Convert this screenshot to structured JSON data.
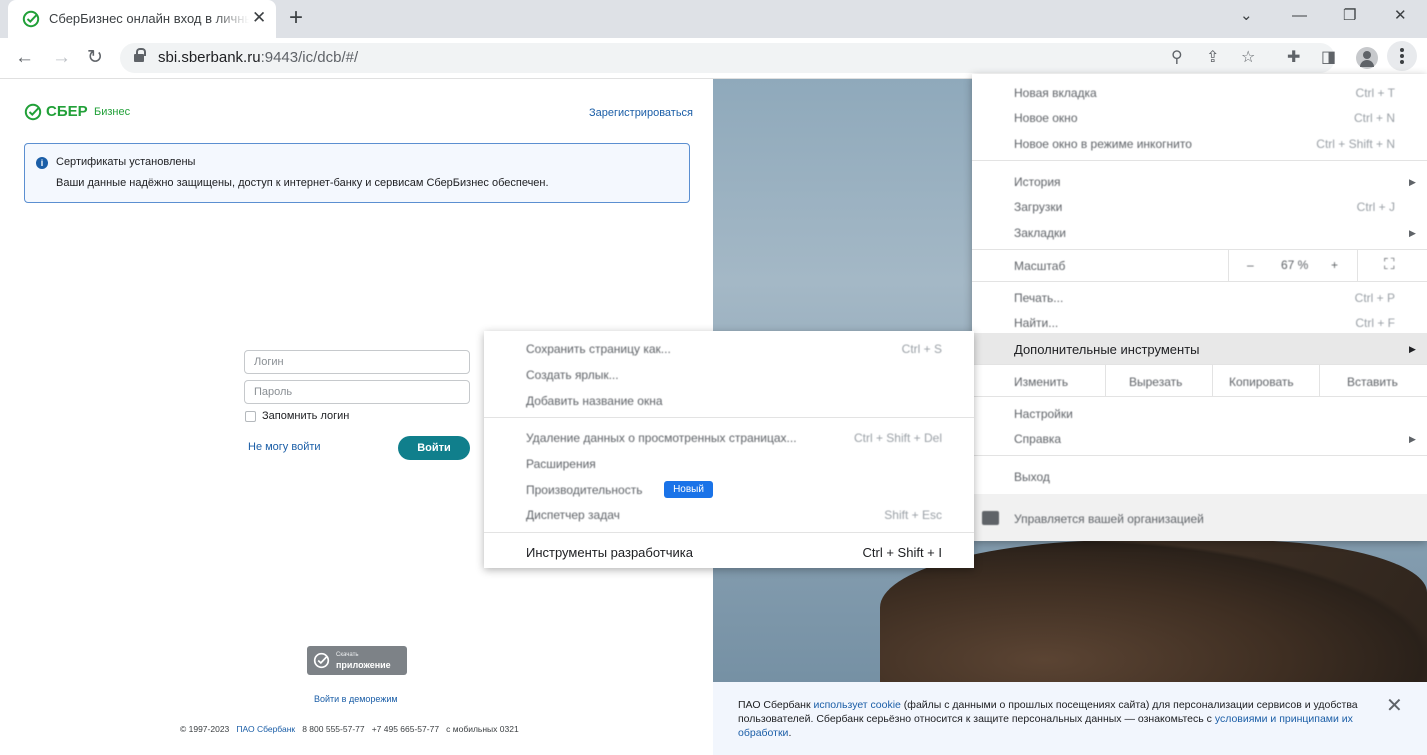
{
  "browser": {
    "tab_title": "СберБизнес онлайн вход в личный кабинет",
    "url_host": "sbi.sberbank.ru",
    "url_path": ":9443/ic/dcb/#/",
    "colors": {
      "tabstrip": "#dee1e6",
      "accent": "#1a73e8"
    }
  },
  "page": {
    "logo_text": "СБЕР",
    "logo_sub": "Бизнес",
    "register_link": "Зарегистрироваться",
    "alert": {
      "title": "Сертификаты установлены",
      "text": "Ваши данные надёжно защищены, доступ к интернет-банку и сервисам СберБизнес обеспечен."
    },
    "login_placeholder": "Логин",
    "password_placeholder": "Пароль",
    "remember_label": "Запомнить логин",
    "cant_login": "Не могу войти",
    "login_button": "Войти",
    "app_badge_small": "Скачать",
    "app_badge_big": "приложение",
    "demo_link": "Войти в деморежим",
    "footer": {
      "copyright": "© 1997-2023",
      "company": "ПАО Сбербанк",
      "phone1": "8 800 555-57-77",
      "phone2": "+7 495 665-57-77",
      "mobile": "с мобильных 0321"
    },
    "cookie": {
      "part1": "ПАО Сбербанк ",
      "link1": "использует cookie",
      "part2": " (файлы с данными о прошлых посещениях сайта) для персонализации сервисов и удобства пользователей. Сбербанк серьёзно относится к защите персональных данных — ознакомьтесь с ",
      "link2": "условиями и принципами их обработки",
      "part3": "."
    },
    "colors": {
      "brand": "#21a038",
      "button": "#107f8c",
      "link": "#1b5ea7"
    }
  },
  "main_menu": {
    "new_tab": "Новая вкладка",
    "new_tab_sc": "Ctrl + T",
    "new_window": "Новое окно",
    "new_window_sc": "Ctrl + N",
    "incognito": "Новое окно в режиме инкогнито",
    "incognito_sc": "Ctrl + Shift + N",
    "history": "История",
    "downloads": "Загрузки",
    "downloads_sc": "Ctrl + J",
    "bookmarks": "Закладки",
    "zoom": "Масштаб",
    "zoom_minus": "–",
    "zoom_value": "67 %",
    "zoom_plus": "+",
    "print": "Печать...",
    "print_sc": "Ctrl + P",
    "find": "Найти...",
    "find_sc": "Ctrl + F",
    "more_tools": "Дополнительные инструменты",
    "edit": "Изменить",
    "cut": "Вырезать",
    "copy": "Копировать",
    "paste": "Вставить",
    "settings": "Настройки",
    "help": "Справка",
    "exit": "Выход",
    "managed": "Управляется вашей организацией"
  },
  "sub_menu": {
    "save_page": "Сохранить страницу как...",
    "save_page_sc": "Ctrl + S",
    "create_shortcut": "Создать ярлык...",
    "name_window": "Добавить название окна",
    "clear_data": "Удаление данных о просмотренных страницах...",
    "clear_data_sc": "Ctrl + Shift + Del",
    "extensions": "Расширения",
    "performance": "Производительность",
    "performance_badge": "Новый",
    "task_manager": "Диспетчер задач",
    "task_manager_sc": "Shift + Esc",
    "dev_tools": "Инструменты разработчика",
    "dev_tools_sc": "Ctrl + Shift + I"
  }
}
